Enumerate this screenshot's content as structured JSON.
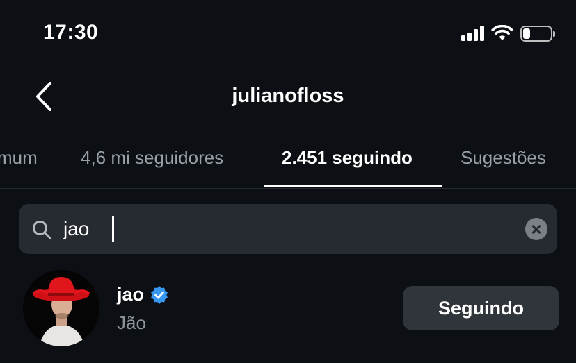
{
  "status_bar": {
    "time": "17:30",
    "battery_level": 0.25
  },
  "header": {
    "title": "julianofloss"
  },
  "tabs": [
    {
      "label": "mum"
    },
    {
      "label": "4,6 mi seguidores"
    },
    {
      "label": "2.451 seguindo",
      "active": true
    },
    {
      "label": "Sugestões"
    }
  ],
  "search": {
    "value": "jao"
  },
  "results": [
    {
      "username": "jao",
      "full_name": "Jão",
      "verified": true,
      "button_label": "Seguindo"
    }
  ],
  "colors": {
    "background": "#0c0f14",
    "search_bg": "#262a31",
    "button_bg": "#30343b",
    "verified": "#3897f0"
  }
}
